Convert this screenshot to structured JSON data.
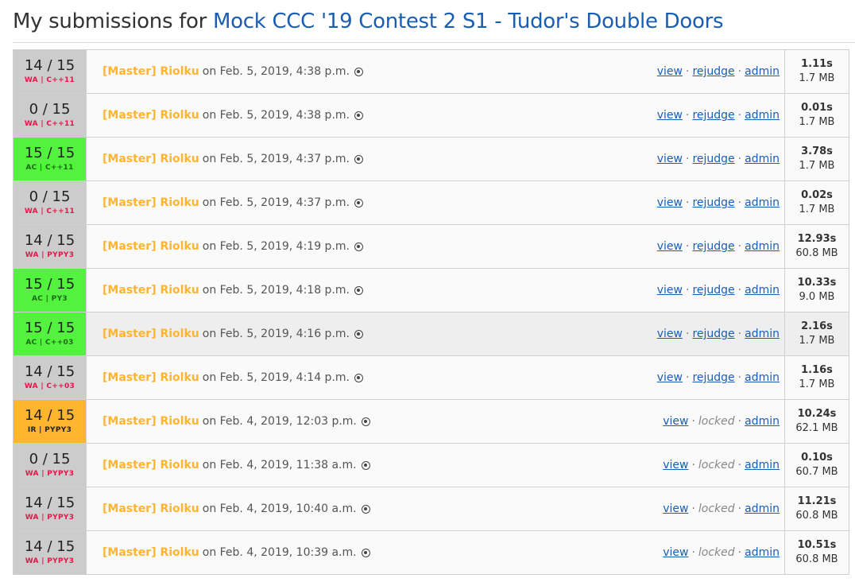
{
  "heading": {
    "prefix": "My submissions for ",
    "problem_link": "Mock CCC '19 Contest 2 S1 - Tudor's Double Doors"
  },
  "colors": {
    "wa": "#cccccc",
    "ac": "#53f23f",
    "ir": "#ffb52f",
    "user": "#ffb52f",
    "link": "#1a5eb3"
  },
  "submissions": [
    {
      "score": "14 / 15",
      "status": "WA | C++11",
      "result": "wa",
      "user": "[Master] Riolku",
      "on": "on Feb. 5, 2019, 4:38 p.m.",
      "actions": [
        "view",
        "rejudge",
        "admin"
      ],
      "time": "1.11s",
      "memory": "1.7 MB"
    },
    {
      "score": "0 / 15",
      "status": "WA | C++11",
      "result": "wa",
      "user": "[Master] Riolku",
      "on": "on Feb. 5, 2019, 4:38 p.m.",
      "actions": [
        "view",
        "rejudge",
        "admin"
      ],
      "time": "0.01s",
      "memory": "1.7 MB"
    },
    {
      "score": "15 / 15",
      "status": "AC | C++11",
      "result": "ac",
      "user": "[Master] Riolku",
      "on": "on Feb. 5, 2019, 4:37 p.m.",
      "actions": [
        "view",
        "rejudge",
        "admin"
      ],
      "time": "3.78s",
      "memory": "1.7 MB"
    },
    {
      "score": "0 / 15",
      "status": "WA | C++11",
      "result": "wa",
      "user": "[Master] Riolku",
      "on": "on Feb. 5, 2019, 4:37 p.m.",
      "actions": [
        "view",
        "rejudge",
        "admin"
      ],
      "time": "0.02s",
      "memory": "1.7 MB"
    },
    {
      "score": "14 / 15",
      "status": "WA | PYPY3",
      "result": "wa",
      "user": "[Master] Riolku",
      "on": "on Feb. 5, 2019, 4:19 p.m.",
      "actions": [
        "view",
        "rejudge",
        "admin"
      ],
      "time": "12.93s",
      "memory": "60.8 MB"
    },
    {
      "score": "15 / 15",
      "status": "AC | PY3",
      "result": "ac",
      "user": "[Master] Riolku",
      "on": "on Feb. 5, 2019, 4:18 p.m.",
      "actions": [
        "view",
        "rejudge",
        "admin"
      ],
      "time": "10.33s",
      "memory": "9.0 MB"
    },
    {
      "score": "15 / 15",
      "status": "AC | C++03",
      "result": "ac",
      "user": "[Master] Riolku",
      "on": "on Feb. 5, 2019, 4:16 p.m.",
      "actions": [
        "view",
        "rejudge",
        "admin"
      ],
      "time": "2.16s",
      "memory": "1.7 MB",
      "highlight": true
    },
    {
      "score": "14 / 15",
      "status": "WA | C++03",
      "result": "wa",
      "user": "[Master] Riolku",
      "on": "on Feb. 5, 2019, 4:14 p.m.",
      "actions": [
        "view",
        "rejudge",
        "admin"
      ],
      "time": "1.16s",
      "memory": "1.7 MB"
    },
    {
      "score": "14 / 15",
      "status": "IR | PYPY3",
      "result": "ir",
      "user": "[Master] Riolku",
      "on": "on Feb. 4, 2019, 12:03 p.m.",
      "actions": [
        "view",
        "locked",
        "admin"
      ],
      "time": "10.24s",
      "memory": "62.1 MB"
    },
    {
      "score": "0 / 15",
      "status": "WA | PYPY3",
      "result": "wa",
      "user": "[Master] Riolku",
      "on": "on Feb. 4, 2019, 11:38 a.m.",
      "actions": [
        "view",
        "locked",
        "admin"
      ],
      "time": "0.10s",
      "memory": "60.7 MB"
    },
    {
      "score": "14 / 15",
      "status": "WA | PYPY3",
      "result": "wa",
      "user": "[Master] Riolku",
      "on": "on Feb. 4, 2019, 10:40 a.m.",
      "actions": [
        "view",
        "locked",
        "admin"
      ],
      "time": "11.21s",
      "memory": "60.8 MB"
    },
    {
      "score": "14 / 15",
      "status": "WA | PYPY3",
      "result": "wa",
      "user": "[Master] Riolku",
      "on": "on Feb. 4, 2019, 10:39 a.m.",
      "actions": [
        "view",
        "locked",
        "admin"
      ],
      "time": "10.51s",
      "memory": "60.8 MB"
    }
  ]
}
